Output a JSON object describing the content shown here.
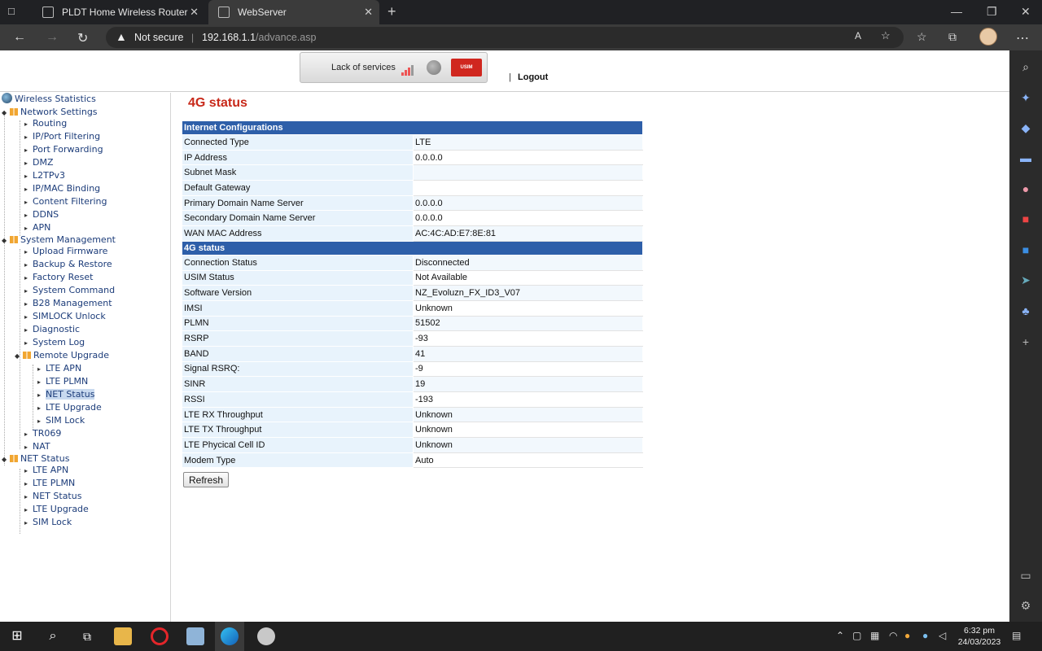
{
  "browser": {
    "tabs": [
      {
        "title": "PLDT Home Wireless Router"
      },
      {
        "title": "WebServer"
      }
    ],
    "address": {
      "security_label": "Not secure",
      "host": "192.168.1.1",
      "path": "/advance.asp"
    }
  },
  "header": {
    "service_status": "Lack of services",
    "usim_label": "USIM",
    "logout_label": "Logout"
  },
  "tree": {
    "root": "Wireless Statistics",
    "network_settings": {
      "label": "Network Settings",
      "items": [
        "Routing",
        "IP/Port Filtering",
        "Port Forwarding",
        "DMZ",
        "L2TPv3",
        "IP/MAC Binding",
        "Content Filtering",
        "DDNS",
        "APN"
      ]
    },
    "system_management": {
      "label": "System Management",
      "items": [
        "Upload Firmware",
        "Backup & Restore",
        "Factory Reset",
        "System Command",
        "B28 Management",
        "SIMLOCK Unlock",
        "Diagnostic",
        "System Log"
      ],
      "remote_upgrade": {
        "label": "Remote Upgrade",
        "items": [
          "LTE APN",
          "LTE PLMN",
          "NET Status",
          "LTE Upgrade",
          "SIM Lock"
        ]
      },
      "after_items": [
        "TR069",
        "NAT"
      ]
    },
    "net_status": {
      "label": "NET Status",
      "items": [
        "LTE APN",
        "LTE PLMN",
        "NET Status",
        "LTE Upgrade",
        "SIM Lock"
      ]
    }
  },
  "main": {
    "title": "4G status",
    "sections": [
      {
        "heading": "Internet Configurations",
        "rows": [
          {
            "key": "Connected Type",
            "value": "LTE"
          },
          {
            "key": "IP Address",
            "value": "0.0.0.0"
          },
          {
            "key": "Subnet Mask",
            "value": ""
          },
          {
            "key": "Default Gateway",
            "value": ""
          },
          {
            "key": "Primary Domain Name Server",
            "value": "0.0.0.0"
          },
          {
            "key": "Secondary Domain Name Server",
            "value": "0.0.0.0"
          },
          {
            "key": "WAN MAC Address",
            "value": "AC:4C:AD:E7:8E:81"
          }
        ]
      },
      {
        "heading": "4G status",
        "rows": [
          {
            "key": "Connection Status",
            "value": "Disconnected"
          },
          {
            "key": "USIM Status",
            "value": "Not Available"
          },
          {
            "key": "Software Version",
            "value": "NZ_Evoluzn_FX_ID3_V07"
          },
          {
            "key": "IMSI",
            "value": "Unknown"
          },
          {
            "key": "PLMN",
            "value": "51502"
          },
          {
            "key": "RSRP",
            "value": "-93"
          },
          {
            "key": "BAND",
            "value": "41"
          },
          {
            "key": "Signal RSRQ:",
            "value": "-9"
          },
          {
            "key": "SINR",
            "value": "19"
          },
          {
            "key": "RSSI",
            "value": "-193"
          },
          {
            "key": "LTE RX Throughput",
            "value": "Unknown"
          },
          {
            "key": "LTE TX Throughput",
            "value": "Unknown"
          },
          {
            "key": "LTE Phycical Cell ID",
            "value": "Unknown"
          },
          {
            "key": "Modem Type",
            "value": "Auto"
          }
        ]
      }
    ],
    "refresh_label": "Refresh"
  },
  "taskbar": {
    "time": "6:32 pm",
    "date": "24/03/2023"
  }
}
